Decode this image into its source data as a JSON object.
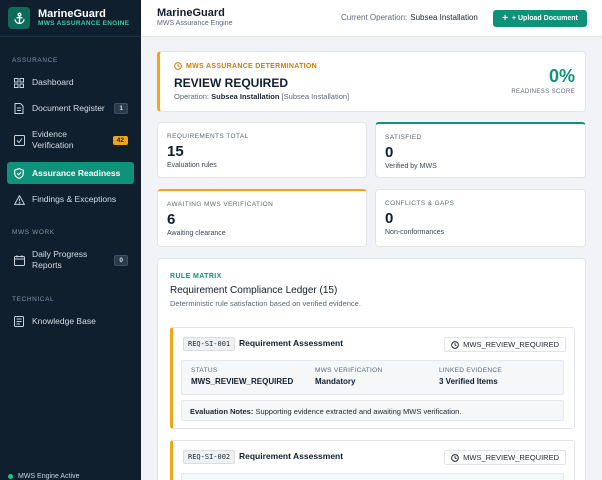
{
  "brand": {
    "name": "MarineGuard",
    "subtitle": "MWS ASSURANCE ENGINE"
  },
  "sidebar": {
    "sections": [
      "ASSURANCE",
      "MWS WORK",
      "TECHNICAL"
    ],
    "items": [
      {
        "label": "Dashboard",
        "icon": "grid-icon"
      },
      {
        "label": "Document Register",
        "icon": "document-icon",
        "badge": "1"
      },
      {
        "label": "Evidence\nVerification",
        "icon": "check-square-icon",
        "badge": "42"
      },
      {
        "label": "Assurance Readiness",
        "icon": "shield-icon",
        "active": true
      },
      {
        "label": "Findings & Exceptions",
        "icon": "warning-icon"
      },
      {
        "label": "Daily Progress\nReports",
        "icon": "calendar-icon",
        "badge": "0"
      },
      {
        "label": "Knowledge Base",
        "icon": "book-icon"
      }
    ],
    "engine_status": "MWS Engine Active"
  },
  "header": {
    "title": "MarineGuard",
    "subtitle": "MWS Assurance Engine",
    "operation_label": "Current Operation:",
    "operation_value": "Subsea Installation",
    "upload_label": "+ Upload Document"
  },
  "determination": {
    "label": "MWS ASSURANCE DETERMINATION",
    "status": "REVIEW REQUIRED",
    "operation_prefix": "Operation:",
    "operation_name": "Subsea Installation",
    "operation_detail": "[Subsea Installation]",
    "score": "0%",
    "score_label": "READINESS SCORE"
  },
  "stats": [
    {
      "title": "REQUIREMENTS TOTAL",
      "value": "15",
      "sub": "Evaluation rules"
    },
    {
      "title": "SATISFIED",
      "value": "0",
      "sub": "Verified by MWS"
    },
    {
      "title": "AWAITING MWS VERIFICATION",
      "value": "6",
      "sub": "Awaiting clearance"
    },
    {
      "title": "CONFLICTS & GAPS",
      "value": "0",
      "sub": "Non-conformances"
    }
  ],
  "ledger": {
    "label": "RULE MATRIX",
    "title": "Requirement Compliance Ledger (15)",
    "subtitle": "Deterministic rule satisfaction based on verified evidence.",
    "requirements": [
      {
        "id": "REQ-SI-001",
        "name": "Requirement Assessment",
        "chip": "MWS_REVIEW_REQUIRED",
        "status_label": "STATUS",
        "status_value": "MWS_REVIEW_REQUIRED",
        "verification_label": "MWS VERIFICATION",
        "verification_value": "Mandatory",
        "evidence_label": "LINKED EVIDENCE",
        "evidence_value": "3 Verified Items",
        "notes_label": "Evaluation Notes:",
        "notes_value": "Supporting evidence extracted and awaiting MWS verification."
      },
      {
        "id": "REQ-SI-002",
        "name": "Requirement Assessment",
        "chip": "MWS_REVIEW_REQUIRED"
      }
    ]
  },
  "colors": {
    "accent": "#10917a",
    "warning": "#f2a516",
    "sidebar": "#0f1f2e"
  }
}
